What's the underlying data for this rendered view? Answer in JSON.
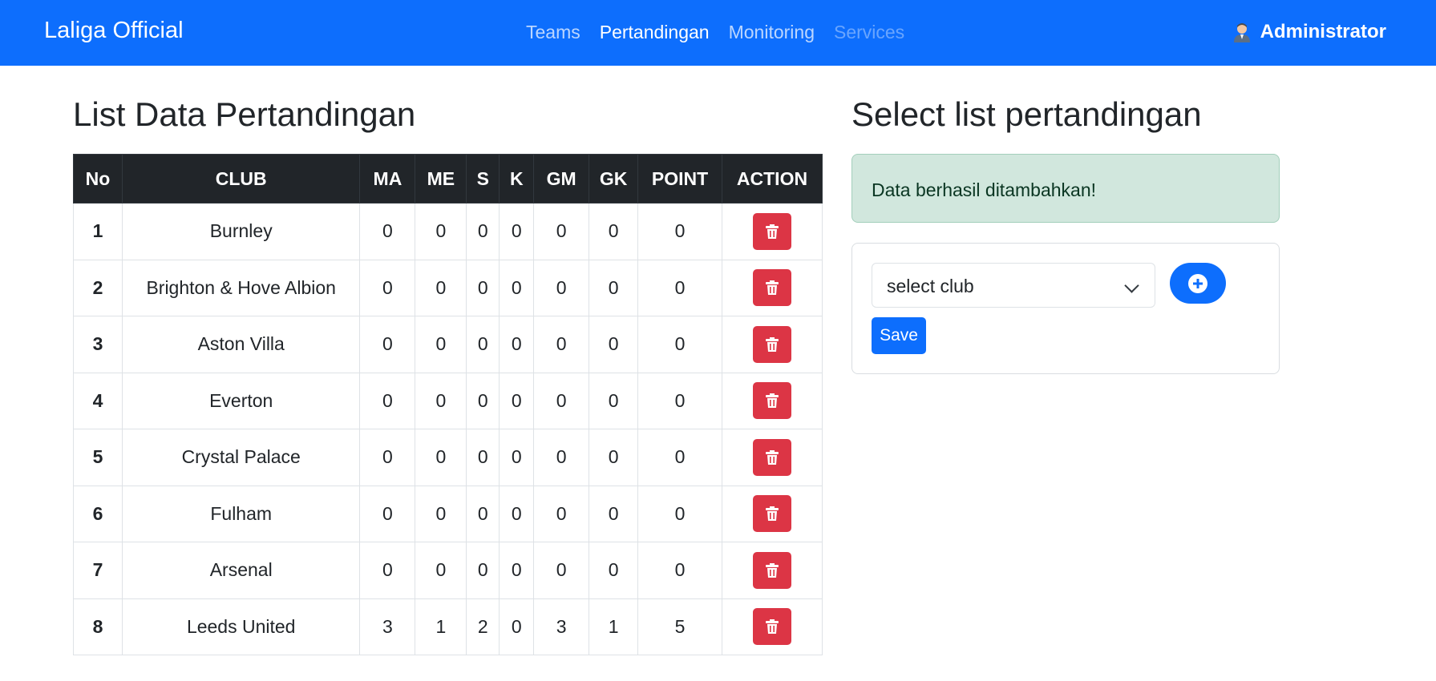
{
  "navbar": {
    "brand": "Laliga Official",
    "links": [
      "Teams",
      "Pertandingan",
      "Monitoring",
      "Services"
    ],
    "user": "Administrator"
  },
  "left": {
    "title": "List Data Pertandingan",
    "headers": [
      "No",
      "CLUB",
      "MA",
      "ME",
      "S",
      "K",
      "GM",
      "GK",
      "POINT",
      "ACTION"
    ],
    "rows": [
      [
        "1",
        "Burnley",
        "0",
        "0",
        "0",
        "0",
        "0",
        "0",
        "0"
      ],
      [
        "2",
        "Brighton & Hove Albion",
        "0",
        "0",
        "0",
        "0",
        "0",
        "0",
        "0"
      ],
      [
        "3",
        "Aston Villa",
        "0",
        "0",
        "0",
        "0",
        "0",
        "0",
        "0"
      ],
      [
        "4",
        "Everton",
        "0",
        "0",
        "0",
        "0",
        "0",
        "0",
        "0"
      ],
      [
        "5",
        "Crystal Palace",
        "0",
        "0",
        "0",
        "0",
        "0",
        "0",
        "0"
      ],
      [
        "6",
        "Fulham",
        "0",
        "0",
        "0",
        "0",
        "0",
        "0",
        "0"
      ],
      [
        "7",
        "Arsenal",
        "0",
        "0",
        "0",
        "0",
        "0",
        "0",
        "0"
      ],
      [
        "8",
        "Leeds United",
        "3",
        "1",
        "2",
        "0",
        "3",
        "1",
        "5"
      ]
    ]
  },
  "right": {
    "title": "Select list pertandingan",
    "alert": "Data berhasil ditambahkan!",
    "select_value": "select club",
    "save_label": "Save"
  },
  "colors": {
    "primary": "#0d6efd",
    "danger": "#dc3545",
    "dark": "#212529",
    "success_bg": "#d1e7dd"
  },
  "icons": {
    "delete": "trash-icon",
    "add": "plus-circle-icon",
    "user": "user-avatar-icon",
    "dropdown": "chevron-down-icon"
  }
}
